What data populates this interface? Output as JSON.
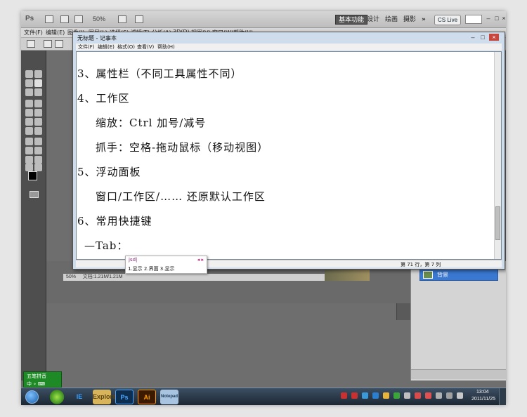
{
  "photoshop": {
    "logo": "Ps",
    "zoom_level": "50%",
    "workspaces": [
      "基本功能",
      "设计",
      "绘画",
      "摄影",
      "»"
    ],
    "cs_live": "CS Live",
    "menu": [
      "文件(F)",
      "编辑(E)",
      "图像(I)",
      "图层(L)",
      "选择(S)",
      "滤镜(T)",
      "分析(A)",
      "3D(D)",
      "视图(V)",
      "窗口(W)",
      "帮助(H)"
    ],
    "doc_status": "50%",
    "doc_info": "文档:1.21M/1.21M",
    "layer_name": "背景"
  },
  "notepad": {
    "title": "无标题 - 记事本",
    "menu": [
      "文件(F)",
      "编辑(E)",
      "格式(O)",
      "查看(V)",
      "帮助(H)"
    ],
    "lines": [
      "3、属性栏（不同工具属性不同）",
      "4、工作区",
      "缩放：Ctrl 加号/减号",
      "抓手：空格-拖动鼠标（移动视图）",
      "5、浮动面板",
      "窗口/工作区/……  还原默认工作区",
      "6、常用快捷键",
      "—Tab："
    ],
    "status_position": "第 71 行，第 7 列"
  },
  "ime_popup": {
    "composition": "jsd|",
    "arrows": "◂ ▸",
    "candidates": "1.显示 2.界面 3.显示"
  },
  "ime_bar": {
    "label": "五笔拼音",
    "icons": "中 ∘ ⌨"
  },
  "taskbar": {
    "apps": [
      "IE",
      "Explorer",
      "Ps",
      "Ai",
      "Notepad"
    ],
    "clock_time": "13:04",
    "clock_date": "2011/11/25"
  },
  "colors": {
    "ps_dark": "#4e4e4e",
    "layer_selected": "#3a78d1",
    "ime_green": "#1e8a26",
    "taskbar": "#1c2733"
  }
}
